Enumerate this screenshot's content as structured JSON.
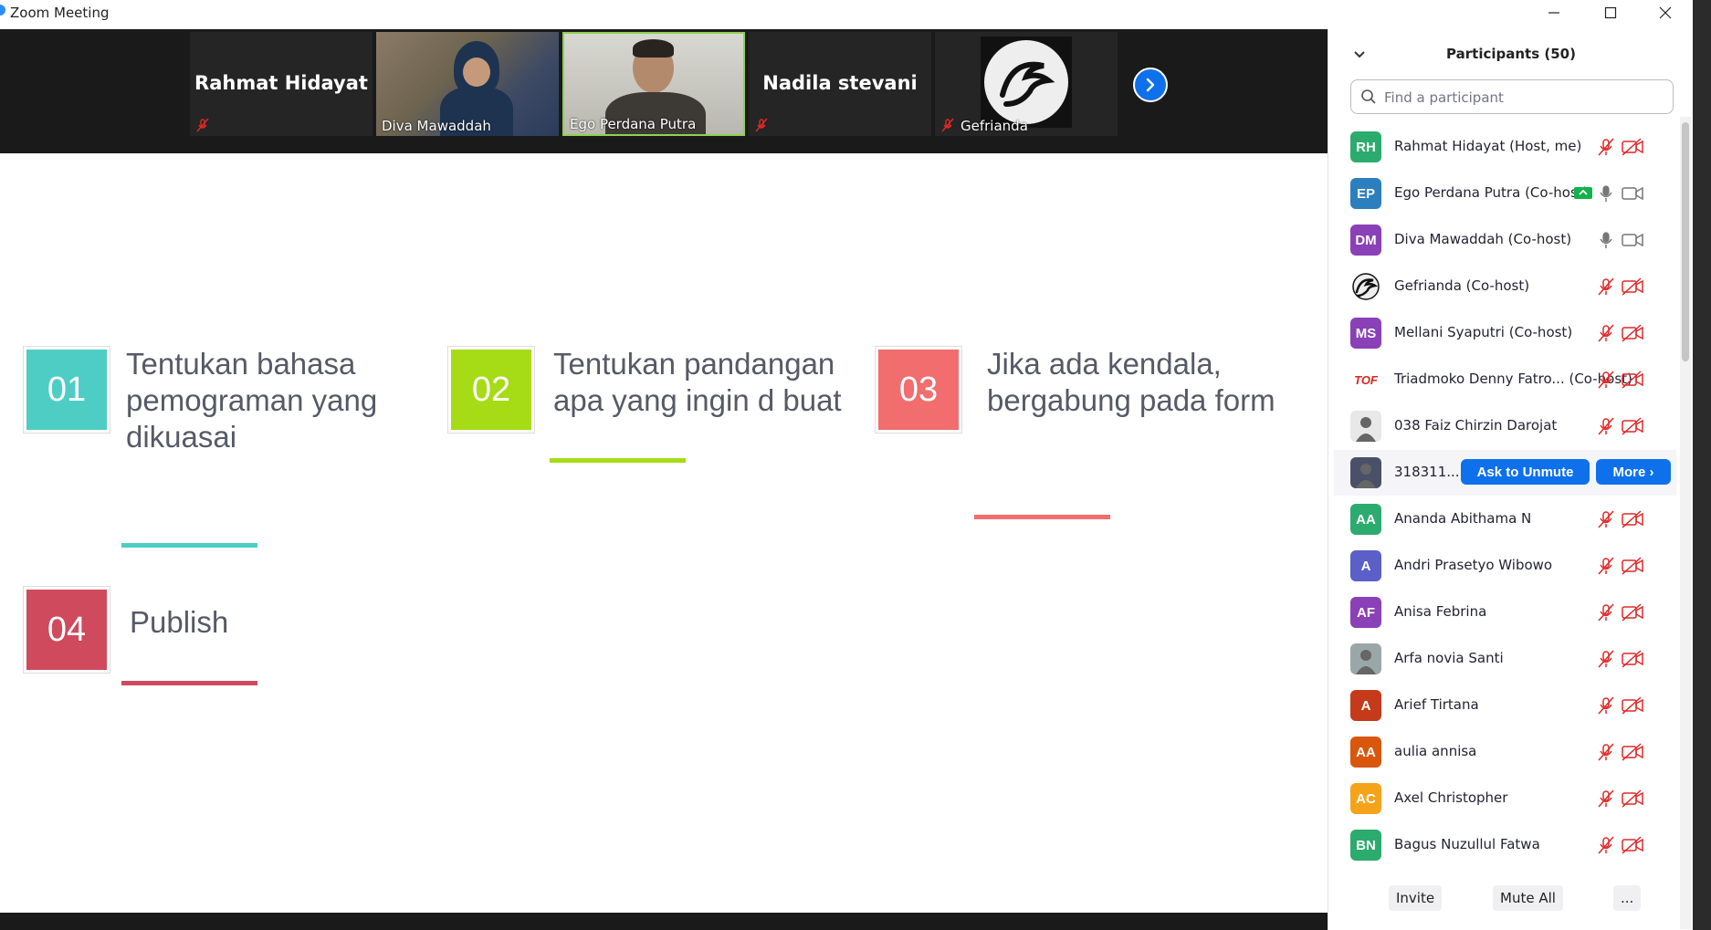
{
  "window": {
    "title": "Zoom Meeting",
    "controls": [
      "minimize-icon",
      "maximize-icon",
      "close-icon"
    ]
  },
  "video_strip": {
    "tiles": [
      {
        "name": "Rahmat Hidayat",
        "type": "name-only",
        "muted": true
      },
      {
        "name": "Diva Mawaddah",
        "type": "video",
        "muted": false
      },
      {
        "name": "Ego Perdana Putra",
        "type": "video",
        "muted": false,
        "active_speaker": true
      },
      {
        "name": "Nadila stevani",
        "type": "name-only",
        "muted": true
      },
      {
        "name": "Gefrianda",
        "type": "avatar",
        "muted": true
      }
    ],
    "next_icon": "chevron-right-icon"
  },
  "slide": {
    "steps": [
      {
        "number": "01",
        "text_lines": [
          "Tentukan bahasa",
          "pemograman yang",
          "dikuasai"
        ],
        "color": "#4ecdc4"
      },
      {
        "number": "02",
        "text_lines": [
          "Tentukan pandangan",
          "apa yang ingin d buat"
        ],
        "color": "#a5dc15"
      },
      {
        "number": "03",
        "text_lines": [
          "Jika ada kendala,",
          "bergabung pada form"
        ],
        "color": "#f26d6d"
      },
      {
        "number": "04",
        "text_lines": [
          "Publish"
        ],
        "color": "#cf4a5c"
      }
    ]
  },
  "participants_panel": {
    "title": "Participants (50)",
    "search_placeholder": "Find a participant",
    "participants": [
      {
        "initials": "RH",
        "name": "Rahmat Hidayat (Host, me)",
        "color": "#2cab6e",
        "mic": "muted",
        "video": "off"
      },
      {
        "initials": "EP",
        "name": "Ego Perdana Putra (Co-host)",
        "color": "#2c7fbe",
        "mic": "on",
        "video": "on",
        "sharing": true
      },
      {
        "initials": "DM",
        "name": "Diva Mawaddah (Co-host)",
        "color": "#8a40b6",
        "mic": "on",
        "video": "on"
      },
      {
        "initials": "",
        "name": "Gefrianda (Co-host)",
        "color": "#ffffff",
        "mic": "muted",
        "video": "off",
        "avatar": "dragon-logo"
      },
      {
        "initials": "MS",
        "name": "Mellani Syaputri (Co-host)",
        "color": "#8a40b6",
        "mic": "muted",
        "video": "off"
      },
      {
        "initials": "",
        "name": "Triadmoko Denny Fatro... (Co-host)",
        "color": "#ffffff",
        "mic": "muted",
        "video": "off",
        "avatar": "tof-logo"
      },
      {
        "initials": "",
        "name": "038 Faiz Chirzin Darojat",
        "color": "#e8e8e8",
        "mic": "muted",
        "video": "off",
        "avatar": "photo"
      },
      {
        "initials": "",
        "name": "318311...",
        "color": "#4a5068",
        "mic": "muted",
        "video": "off",
        "avatar": "photo",
        "hovered": true,
        "ask_unmute": "Ask to Unmute",
        "more": "More ›"
      },
      {
        "initials": "AA",
        "name": "Ananda Abithama N",
        "color": "#2cab6e",
        "mic": "muted",
        "video": "off"
      },
      {
        "initials": "A",
        "name": "Andri Prasetyo Wibowo",
        "color": "#5b5fc7",
        "mic": "muted",
        "video": "off"
      },
      {
        "initials": "AF",
        "name": "Anisa Febrina",
        "color": "#8a40b6",
        "mic": "muted",
        "video": "off"
      },
      {
        "initials": "",
        "name": "Arfa novia Santi",
        "color": "#9aa7a9",
        "mic": "muted",
        "video": "off",
        "avatar": "photo"
      },
      {
        "initials": "A",
        "name": "Arief Tirtana",
        "color": "#c43a1b",
        "mic": "muted",
        "video": "off"
      },
      {
        "initials": "AA",
        "name": "aulia annisa",
        "color": "#d9570d",
        "mic": "muted",
        "video": "off"
      },
      {
        "initials": "AC",
        "name": "Axel Christopher",
        "color": "#f5a31a",
        "mic": "muted",
        "video": "off"
      },
      {
        "initials": "BN",
        "name": "Bagus Nuzullul Fatwa",
        "color": "#2cab6e",
        "mic": "muted",
        "video": "off"
      }
    ],
    "footer": {
      "invite": "Invite",
      "mute_all": "Mute All",
      "more": "..."
    }
  }
}
